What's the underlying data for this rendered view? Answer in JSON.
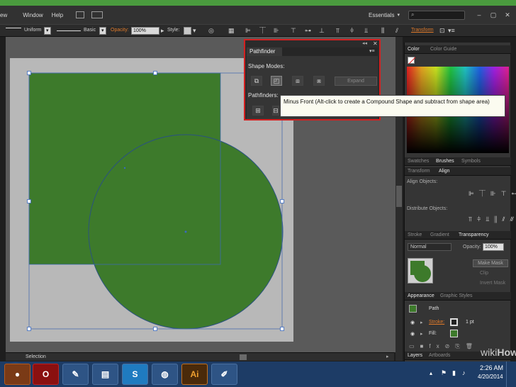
{
  "menubar": {
    "items": [
      "ew",
      "Window",
      "Help"
    ],
    "workspace": "Essentials"
  },
  "control_bar": {
    "stroke_uniform": "Uniform",
    "brush_basic": "Basic",
    "opacity_label": "Opacity:",
    "opacity_value": "100%",
    "style_label": "Style:",
    "transform_label": "Transform"
  },
  "pathfinder": {
    "title": "Pathfinder",
    "shape_modes_label": "Shape Modes:",
    "pathfinders_label": "Pathfinders:",
    "expand_label": "Expand",
    "shape_mode_icons": [
      "unite-icon",
      "minus-front-icon",
      "intersect-icon",
      "exclude-icon"
    ],
    "pathfinder_icons": [
      "divide-icon",
      "trim-icon"
    ]
  },
  "tooltip": {
    "text": "Minus Front (Alt-click to create a Compound Shape and subtract from shape area)"
  },
  "panels": {
    "color_tabs": [
      "Color",
      "Color Guide"
    ],
    "swatch_tabs": [
      "Swatches",
      "Brushes",
      "Symbols"
    ],
    "align_tabs": [
      "Transform",
      "Align"
    ],
    "align_objects_label": "Align Objects:",
    "distribute_objects_label": "Distribute Objects:",
    "transparency_tabs": [
      "Stroke",
      "Gradient",
      "Transparency"
    ],
    "blend_mode": "Normal",
    "opacity_label": "Opacity:",
    "opacity_value": "100%",
    "make_mask": "Make Mask",
    "clip_label": "Clip",
    "invert_mask": "Invert Mask",
    "appearance_tabs": [
      "Appearance",
      "Graphic Styles"
    ],
    "path_label": "Path",
    "stroke_label": "Stroke:",
    "stroke_value": "1 pt",
    "fill_label": "Fill:",
    "layers_tabs": [
      "Layers",
      "Artboards"
    ]
  },
  "status": {
    "tool": "Selection"
  },
  "taskbar": {
    "time": "2:26 AM",
    "date": "4/20/2014",
    "illustrator_label": "Ai"
  },
  "watermark": {
    "wiki": "wiki",
    "how": "How"
  },
  "colors": {
    "shape_green": "#3d7a2b",
    "highlight_red": "#d42020",
    "taskbar_blue": "#1d3c66"
  }
}
